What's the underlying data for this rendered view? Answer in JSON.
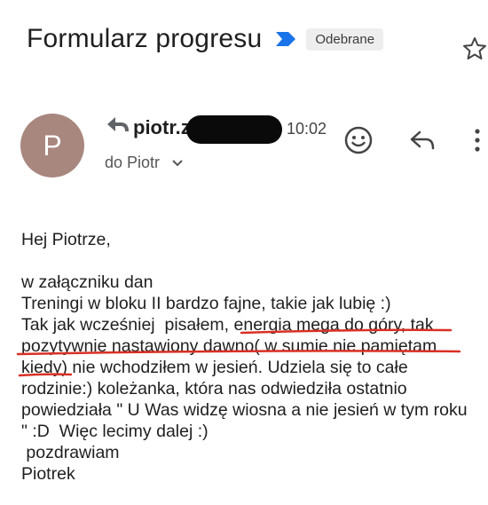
{
  "email": {
    "subject": "Formularz progresu",
    "label": "Odebrane",
    "sender_visible": "piotr.z",
    "time": "10:02",
    "recipient": "do Piotr",
    "avatar_letter": "P",
    "body_lines": [
      "Hej Piotrze,",
      "",
      "w załączniku dan",
      "Treningi w bloku II bardzo fajne, takie jak lubię :)",
      "Tak jak wcześniej  pisałem, energia mega do góry, tak",
      "pozytywnie nastawiony dawno( w sumie nie pamiętam",
      "kiedy) nie wchodziłem w jesień. Udziela się to całe",
      "rodzinie:) koleżanka, która nas odwiedziła ostatnio",
      "powiedziała \" U Was widzę wiosna a nie jesień w tym roku",
      "\" :D  Więc lecimy dalej :)",
      " pozdrawiam",
      "Piotrek"
    ]
  },
  "icons": {
    "importance": "importance-marker-icon",
    "star": "star-icon",
    "reply_small": "reply-arrow-icon",
    "expand": "chevron-down-icon",
    "emoji": "emoji-reaction-icon",
    "reply": "reply-icon",
    "more": "more-vertical-icon"
  },
  "colors": {
    "importance": "#1a73e8",
    "avatar": "#a8877f",
    "underline": "#d93025"
  }
}
